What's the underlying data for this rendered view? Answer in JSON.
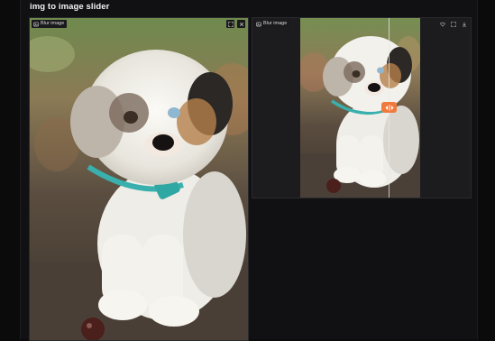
{
  "app": {
    "title": "img to image slider"
  },
  "left_panel": {
    "label": "Blur image",
    "image_alt": "Puppy photo",
    "tools": [
      {
        "icon": "expand-icon"
      },
      {
        "icon": "close-icon"
      }
    ]
  },
  "right_panel": {
    "label": "Blur image",
    "image_alt": "Puppy photo comparison slider",
    "slider_position": 0.73,
    "tools": [
      {
        "icon": "heart-icon"
      },
      {
        "icon": "expand-icon"
      },
      {
        "icon": "download-icon"
      }
    ]
  },
  "colors": {
    "background": "#111113",
    "panel": "#1a1a1c",
    "accent": "#f07a3e"
  }
}
